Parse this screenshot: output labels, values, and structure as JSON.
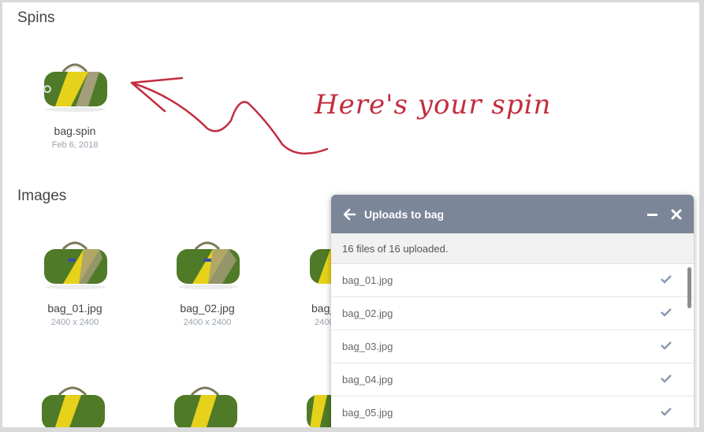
{
  "sections": {
    "spins_title": "Spins",
    "images_title": "Images"
  },
  "spin_item": {
    "name": "bag.spin",
    "date": "Feb 6, 2018"
  },
  "images": [
    {
      "name": "bag_01.jpg",
      "dims": "2400 x 2400"
    },
    {
      "name": "bag_02.jpg",
      "dims": "2400 x 2400"
    },
    {
      "name": "bag_",
      "dims": "2400"
    }
  ],
  "annotation": {
    "text": "Here's your spin"
  },
  "upload_panel": {
    "title": "Uploads to bag",
    "status": "16 files of 16 uploaded.",
    "files": [
      {
        "name": "bag_01.jpg"
      },
      {
        "name": "bag_02.jpg"
      },
      {
        "name": "bag_03.jpg"
      },
      {
        "name": "bag_04.jpg"
      },
      {
        "name": "bag_05.jpg"
      }
    ]
  },
  "colors": {
    "accent_red": "#c22e3f",
    "panel_header": "#7b8699",
    "check": "#8a9aae"
  },
  "icons": [
    "arrow-left-icon",
    "minimize-icon",
    "close-icon",
    "check-icon"
  ]
}
